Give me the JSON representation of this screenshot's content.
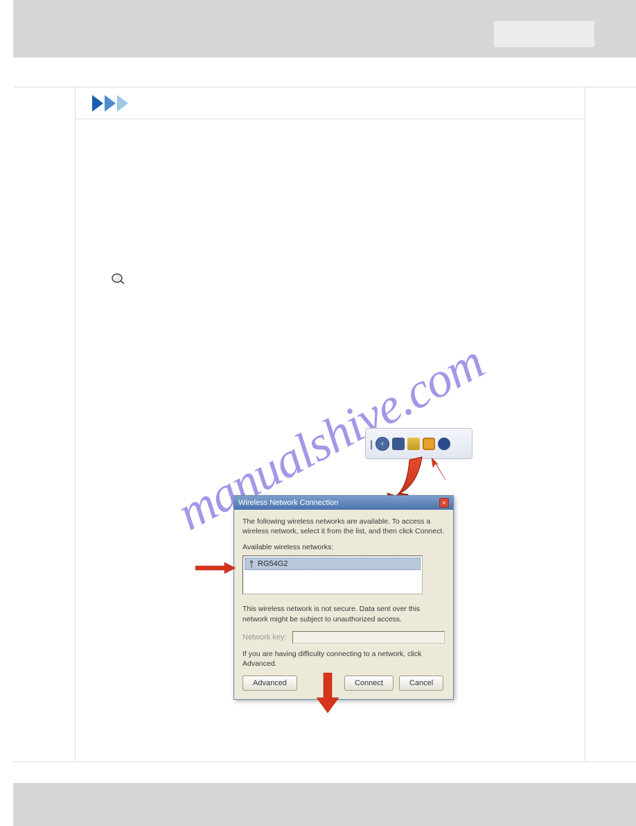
{
  "watermark": "manualshive.com",
  "dialog": {
    "title": "Wireless Network Connection",
    "intro": "The following wireless networks are available. To access a wireless network, select it from the list, and then click Connect.",
    "available_label": "Available wireless networks:",
    "network_items": [
      "RG54G2"
    ],
    "warning": "This wireless network is not secure. Data sent over this network might be subject to unauthorized access.",
    "networkkey_label": "Network key:",
    "trouble_text": "If you are having difficulty connecting to a network, click Advanced.",
    "buttons": {
      "advanced": "Advanced",
      "connect": "Connect",
      "cancel": "Cancel"
    }
  }
}
